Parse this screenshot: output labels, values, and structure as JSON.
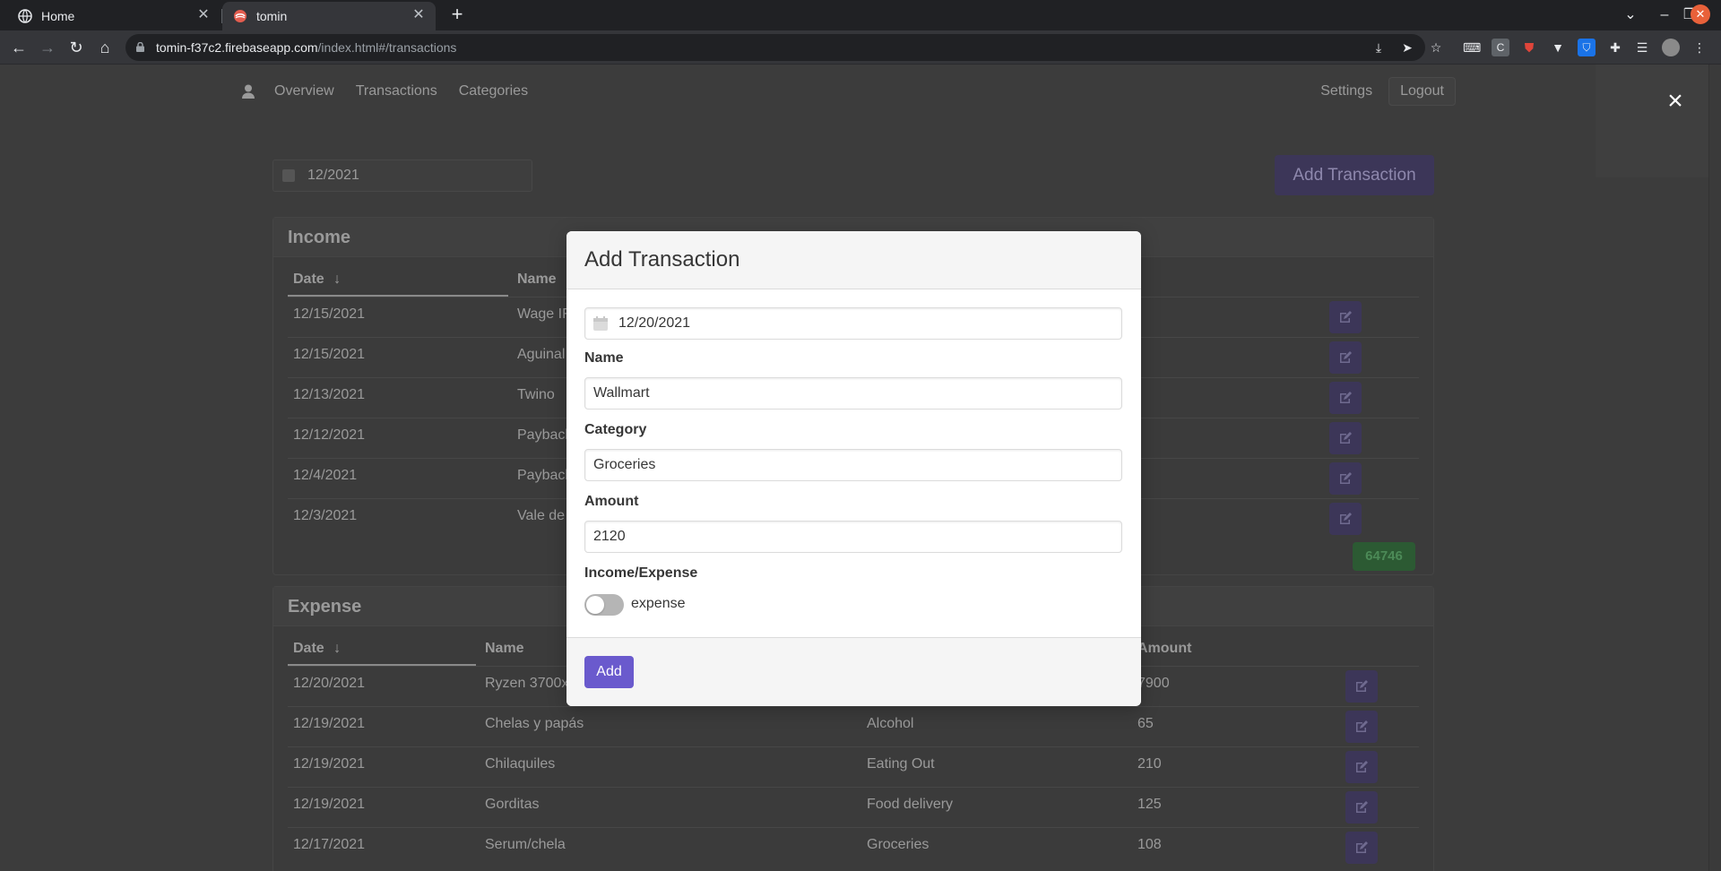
{
  "browser": {
    "tabs": [
      {
        "title": "Home",
        "active": false
      },
      {
        "title": "tomin",
        "active": true
      }
    ],
    "new_tab_label": "+",
    "url_host": "tomin-f37c2.firebaseapp.com",
    "url_path": "/index.html#/transactions"
  },
  "app": {
    "nav": {
      "overview": "Overview",
      "transactions": "Transactions",
      "categories": "Categories",
      "settings": "Settings",
      "logout": "Logout"
    },
    "month": "12/2021",
    "add_transaction_label": "Add Transaction",
    "income": {
      "title": "Income",
      "headers": {
        "date": "Date",
        "name": "Name"
      },
      "rows": [
        {
          "date": "12/15/2021",
          "name": "Wage IF"
        },
        {
          "date": "12/15/2021",
          "name": "Aguinal"
        },
        {
          "date": "12/13/2021",
          "name": "Twino"
        },
        {
          "date": "12/12/2021",
          "name": "Payback"
        },
        {
          "date": "12/4/2021",
          "name": "Payback"
        },
        {
          "date": "12/3/2021",
          "name": "Vale de"
        }
      ],
      "total": "64746"
    },
    "expense": {
      "title": "Expense",
      "headers": {
        "date": "Date",
        "name": "Name",
        "amount": "Amount"
      },
      "rows": [
        {
          "date": "12/20/2021",
          "name": "Ryzen 3700x",
          "category": "",
          "amount": "7900"
        },
        {
          "date": "12/19/2021",
          "name": "Chelas y papás",
          "category": "Alcohol",
          "amount": "65"
        },
        {
          "date": "12/19/2021",
          "name": "Chilaquiles",
          "category": "Eating Out",
          "amount": "210"
        },
        {
          "date": "12/19/2021",
          "name": "Gorditas",
          "category": "Food delivery",
          "amount": "125"
        },
        {
          "date": "12/17/2021",
          "name": "Serum/chela",
          "category": "Groceries",
          "amount": "108"
        }
      ]
    }
  },
  "modal": {
    "title": "Add Transaction",
    "date": "12/20/2021",
    "name_label": "Name",
    "name_value": "Wallmart",
    "category_label": "Category",
    "category_value": "Groceries",
    "amount_label": "Amount",
    "amount_value": "2120",
    "type_label": "Income/Expense",
    "type_value": "expense",
    "submit_label": "Add",
    "close_label": "×"
  },
  "colors": {
    "primary": "#6a5acd",
    "total_badge": "#2c5a33",
    "toggle_off": "#b5b5b5"
  },
  "icons": [
    "globe-icon",
    "tomin-favicon-icon",
    "lock-icon",
    "calendar-icon",
    "user-icon",
    "edit-icon",
    "sort-down-icon"
  ]
}
